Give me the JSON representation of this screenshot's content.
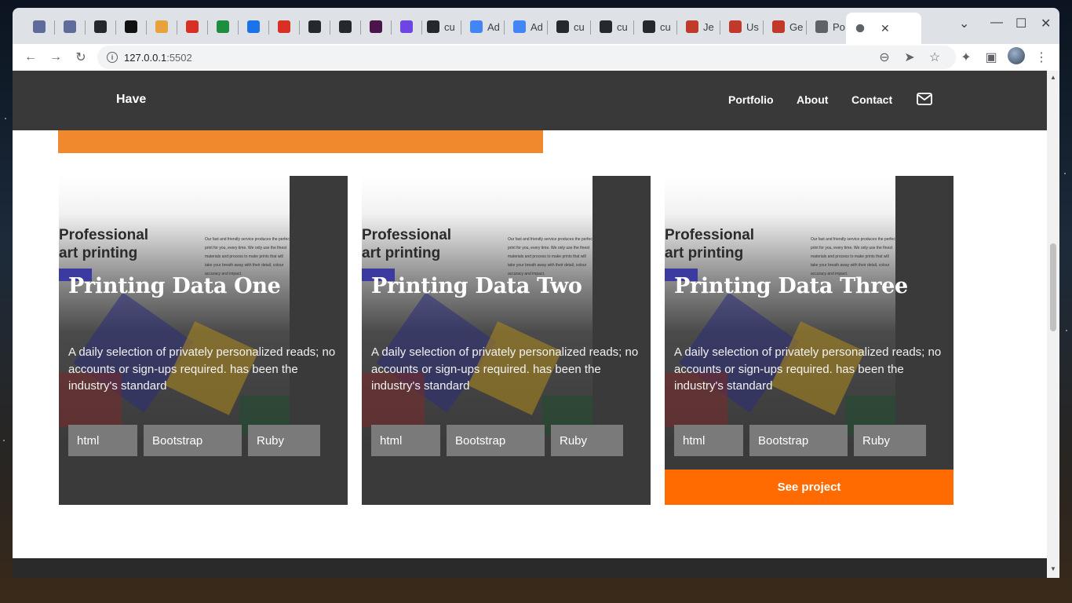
{
  "browser": {
    "tabs": [
      {
        "label": "",
        "favicon": "wallet-icon",
        "color": "#5f6b9a"
      },
      {
        "label": "",
        "favicon": "wallet-icon",
        "color": "#5f6b9a"
      },
      {
        "label": "",
        "favicon": "github-icon",
        "color": "#24292e"
      },
      {
        "label": "",
        "favicon": "code-icon",
        "color": "#111111"
      },
      {
        "label": "",
        "favicon": "pinwheel-icon",
        "color": "#e8a23c"
      },
      {
        "label": "",
        "favicon": "gmail-icon",
        "color": "#d93025"
      },
      {
        "label": "",
        "favicon": "w-icon",
        "color": "#1e8e3e"
      },
      {
        "label": "",
        "favicon": "calendar-icon",
        "color": "#1a73e8"
      },
      {
        "label": "",
        "favicon": "gauge-icon",
        "color": "#d93025"
      },
      {
        "label": "",
        "favicon": "github-icon",
        "color": "#24292e"
      },
      {
        "label": "",
        "favicon": "github-icon",
        "color": "#24292e"
      },
      {
        "label": "",
        "favicon": "slack-icon",
        "color": "#4a154b"
      },
      {
        "label": "",
        "favicon": "m-icon",
        "color": "#6e45e2"
      },
      {
        "label": "cu",
        "favicon": "github-icon",
        "color": "#24292e"
      },
      {
        "label": "Ad",
        "favicon": "docs-icon",
        "color": "#4285f4"
      },
      {
        "label": "Ad",
        "favicon": "docs-icon",
        "color": "#4285f4"
      },
      {
        "label": "cu",
        "favicon": "github-icon",
        "color": "#24292e"
      },
      {
        "label": "cu",
        "favicon": "github-icon",
        "color": "#24292e"
      },
      {
        "label": "cu",
        "favicon": "github-icon",
        "color": "#24292e"
      },
      {
        "label": "Je",
        "favicon": "ruby-icon",
        "color": "#c0392b"
      },
      {
        "label": "Us",
        "favicon": "ruby-icon",
        "color": "#c0392b"
      },
      {
        "label": "Ge",
        "favicon": "ruby-icon",
        "color": "#c0392b"
      },
      {
        "label": "Po",
        "favicon": "globe-icon",
        "color": "#5f6368"
      }
    ],
    "url_host": "127.0.0.1",
    "url_port": ":5502"
  },
  "site": {
    "brand": "Have",
    "nav": [
      "Portfolio",
      "About",
      "Contact"
    ]
  },
  "screenshot": {
    "heading_line1": "Professional",
    "heading_line2": "art printing",
    "paragraph": "Our fast and friendly service produces the perfect print for you, every time. We only use the finest materials and process to make prints that will take your breath away with their detail, colour accuracy and impact."
  },
  "cards": [
    {
      "title": "Printing Data One",
      "description": "A daily selection of privately personalized reads; no accounts or sign-ups required. has been the industry's standard",
      "tags": [
        "html",
        "Bootstrap",
        "Ruby"
      ]
    },
    {
      "title": "Printing Data Two",
      "description": "A daily selection of privately personalized reads; no accounts or sign-ups required. has been the industry's standard",
      "tags": [
        "html",
        "Bootstrap",
        "Ruby"
      ]
    },
    {
      "title": "Printing Data Three",
      "description": "A daily selection of privately personalized reads; no accounts or sign-ups required. has been the industry's standard",
      "tags": [
        "html",
        "Bootstrap",
        "Ruby"
      ],
      "button": "See project"
    }
  ],
  "colors": {
    "header": "#393939",
    "accent_orange": "#ff6b00",
    "banner_orange": "#f0892e",
    "card_bg": "#3a3a3a",
    "tag_bg": "#7a7a7a"
  }
}
